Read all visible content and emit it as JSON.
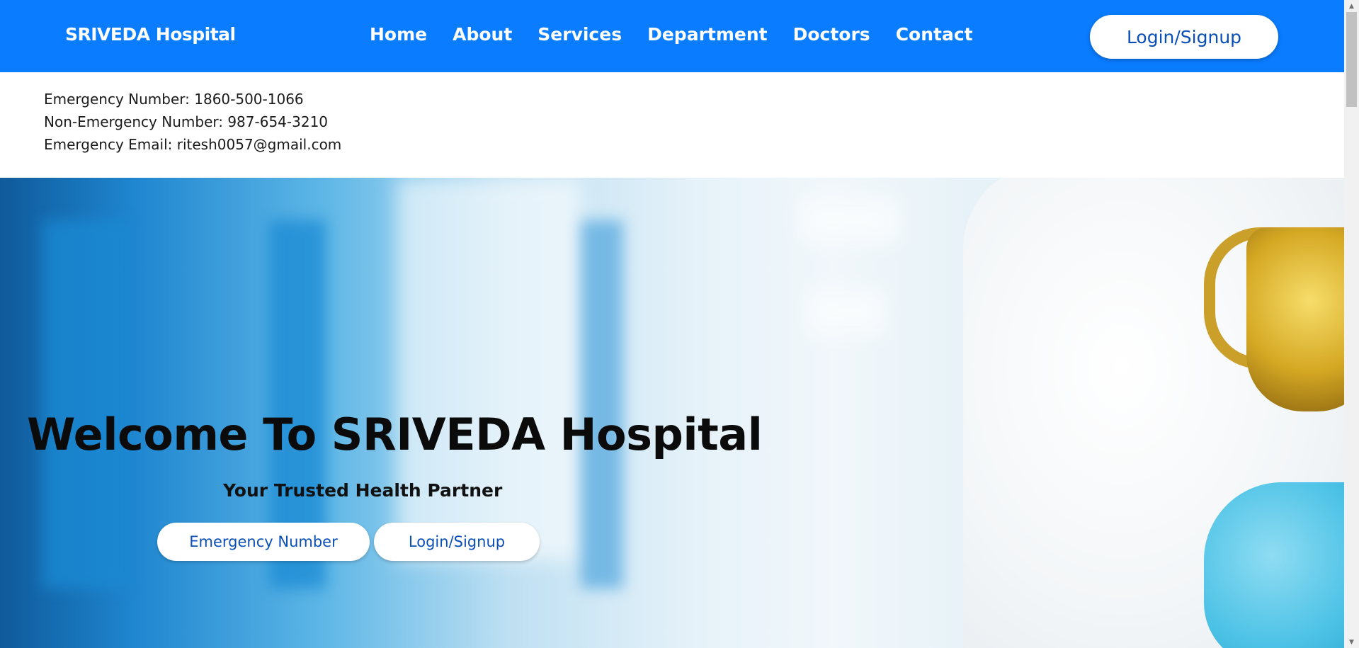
{
  "nav": {
    "brand": "SRIVEDA Hospital",
    "links": [
      "Home",
      "About",
      "Services",
      "Department",
      "Doctors",
      "Contact"
    ],
    "login_label": "Login/Signup"
  },
  "contact": {
    "emergency_number": "Emergency Number: 1860-500-1066",
    "non_emergency_number": "Non-Emergency Number: 987-654-3210",
    "emergency_email": "Emergency Email: ritesh0057@gmail.com"
  },
  "hero": {
    "title": "Welcome To SRIVEDA Hospital",
    "subtitle": "Your Trusted Health Partner",
    "buttons": {
      "emergency": "Emergency Number",
      "login": "Login/Signup"
    }
  },
  "colors": {
    "navbar": "#0a7cff",
    "button_text": "#0a4fb8"
  },
  "icons": {
    "scroll_up": "scroll-up-arrow-icon",
    "scroll_down": "scroll-down-arrow-icon"
  }
}
